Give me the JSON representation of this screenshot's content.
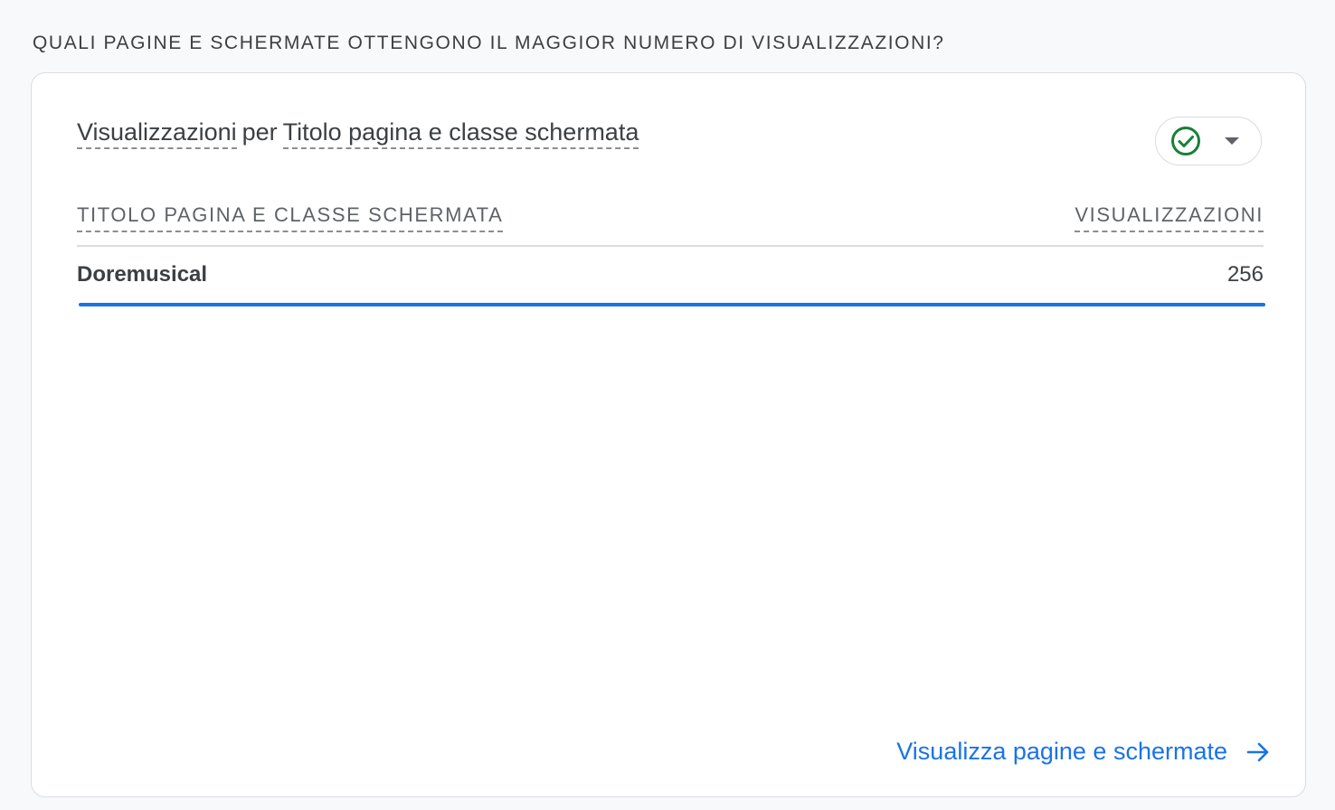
{
  "section_title": "QUALI PAGINE E SCHERMATE OTTENGONO IL MAGGIOR NUMERO DI VISUALIZZAZIONI?",
  "card": {
    "metric": "Visualizzazioni",
    "connector": "per",
    "dimension": "Titolo pagina e classe schermata",
    "status_icon": "check-circle-icon",
    "dropdown_icon": "caret-down-icon",
    "status_color": "#188038"
  },
  "table": {
    "columns": [
      "TITOLO PAGINA E CLASSE SCHERMATA",
      "VISUALIZZAZIONI"
    ],
    "rows": [
      {
        "title": "Doremusical",
        "views": "256",
        "bar_fraction": 1.0
      }
    ]
  },
  "footer": {
    "link_label": "Visualizza pagine e schermate",
    "link_icon": "arrow-right-icon"
  },
  "colors": {
    "accent": "#1a73e8",
    "text": "#3c4043",
    "muted": "#5f6368"
  }
}
